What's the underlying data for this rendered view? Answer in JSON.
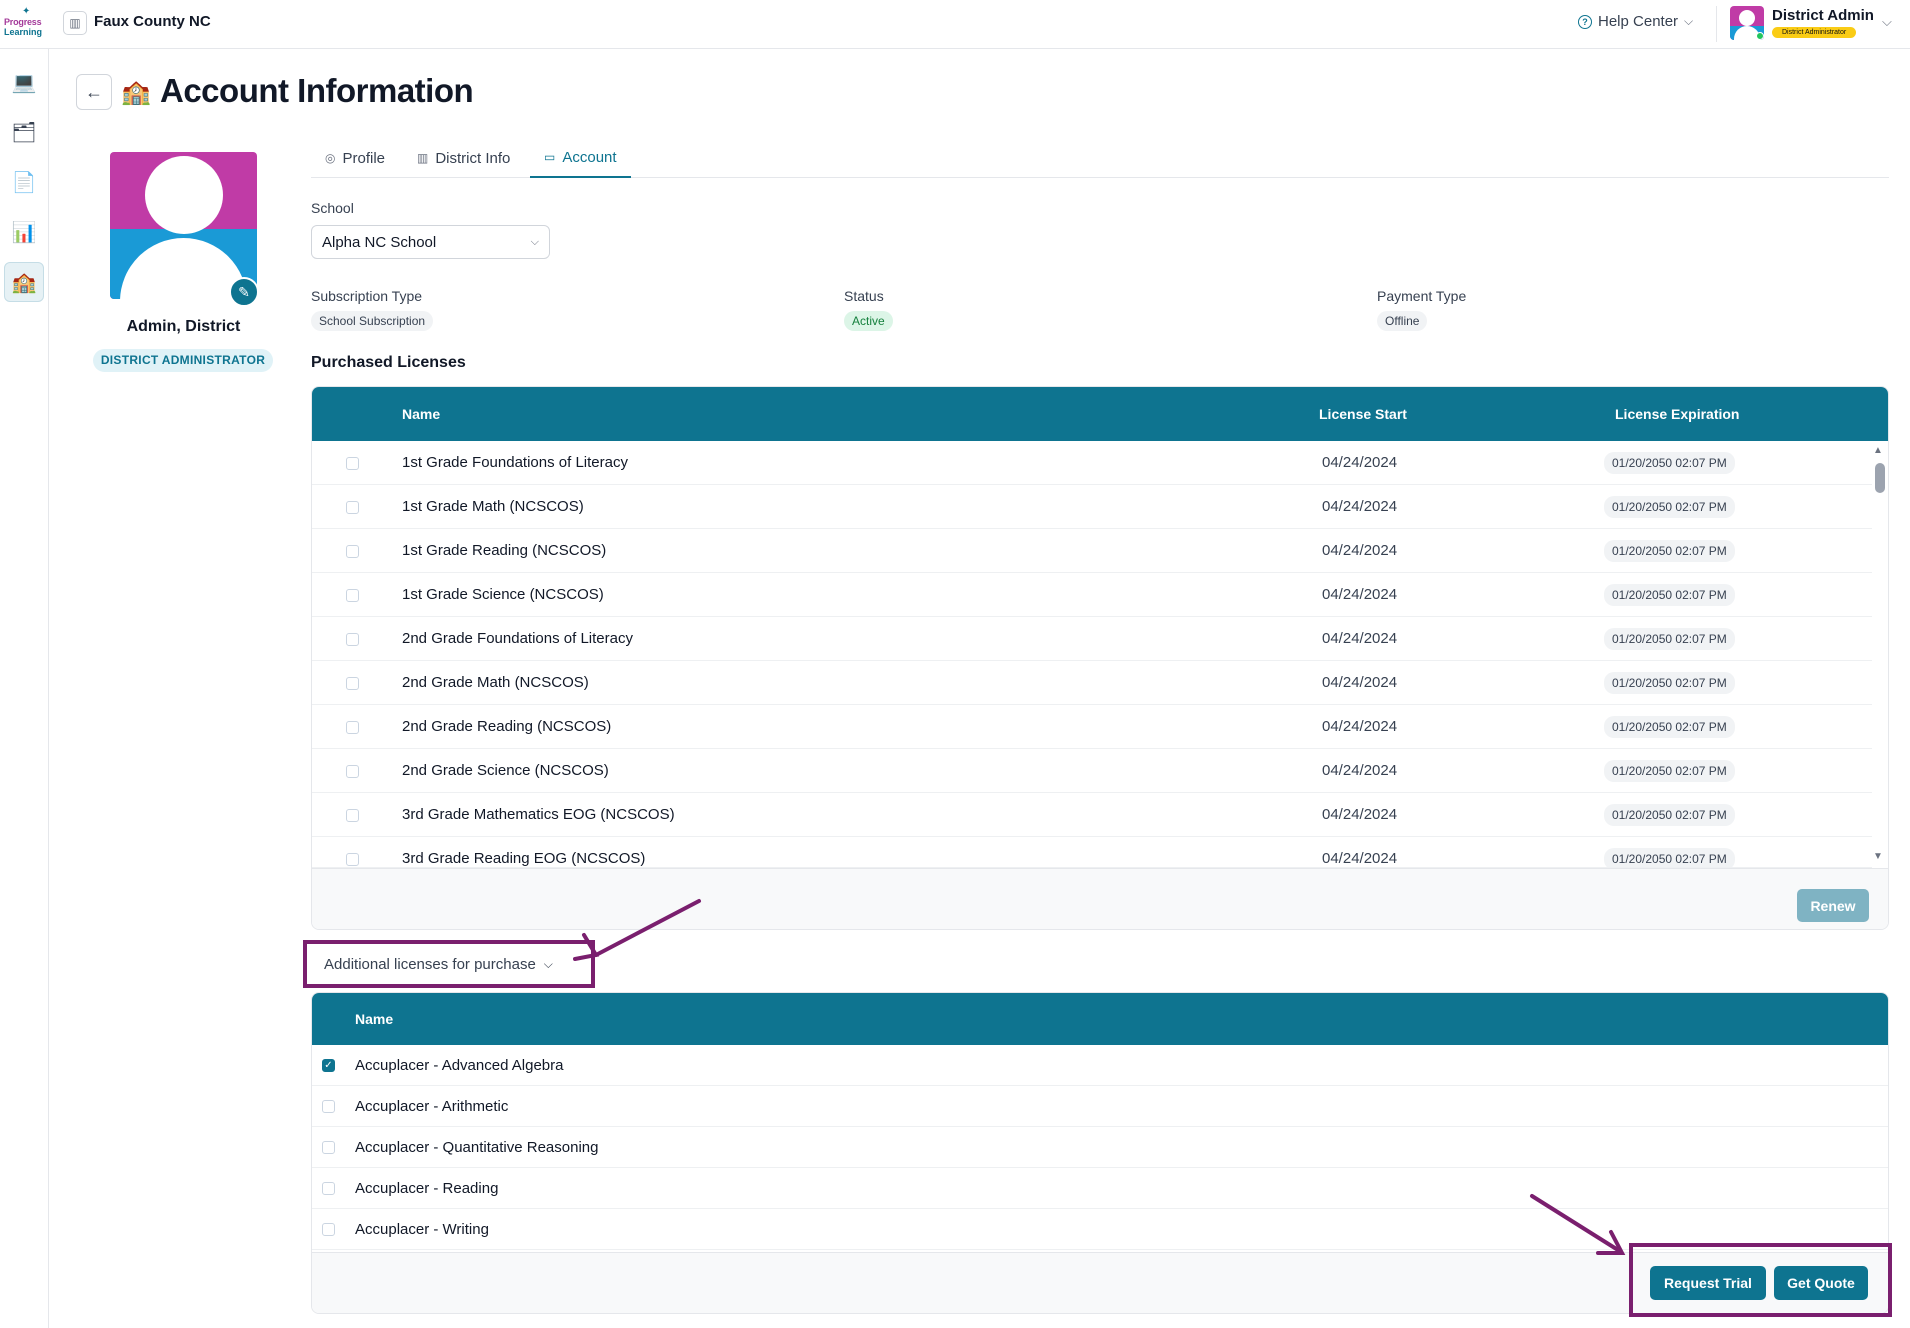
{
  "header": {
    "logo_line1": "Progress",
    "logo_line2": "Learning",
    "org_name": "Faux County NC",
    "help_label": "Help Center",
    "user_name": "District Admin",
    "user_role": "District Administrator"
  },
  "rail": {
    "items": [
      {
        "icon": "laptop-icon"
      },
      {
        "icon": "folders-icon"
      },
      {
        "icon": "report-icon"
      },
      {
        "icon": "analytics-icon"
      },
      {
        "icon": "school-icon",
        "active": true
      }
    ]
  },
  "page": {
    "title": "Account Information"
  },
  "profile": {
    "name": "Admin, District",
    "role": "DISTRICT ADMINISTRATOR"
  },
  "tabs": [
    {
      "label": "Profile",
      "icon": "user-circle-icon"
    },
    {
      "label": "District Info",
      "icon": "building-icon"
    },
    {
      "label": "Account",
      "icon": "card-icon",
      "active": true
    }
  ],
  "account": {
    "school_label": "School",
    "school_value": "Alpha NC School",
    "subscription_label": "Subscription Type",
    "subscription_value": "School Subscription",
    "status_label": "Status",
    "status_value": "Active",
    "payment_label": "Payment Type",
    "payment_value": "Offline"
  },
  "purchased": {
    "title": "Purchased Licenses",
    "columns": {
      "name": "Name",
      "start": "License Start",
      "expiration": "License Expiration"
    },
    "rows": [
      {
        "name": "1st Grade Foundations of Literacy",
        "start": "04/24/2024",
        "expiration": "01/20/2050 02:07 PM"
      },
      {
        "name": "1st Grade Math (NCSCOS)",
        "start": "04/24/2024",
        "expiration": "01/20/2050 02:07 PM"
      },
      {
        "name": "1st Grade Reading (NCSCOS)",
        "start": "04/24/2024",
        "expiration": "01/20/2050 02:07 PM"
      },
      {
        "name": "1st Grade Science (NCSCOS)",
        "start": "04/24/2024",
        "expiration": "01/20/2050 02:07 PM"
      },
      {
        "name": "2nd Grade Foundations of Literacy",
        "start": "04/24/2024",
        "expiration": "01/20/2050 02:07 PM"
      },
      {
        "name": "2nd Grade Math (NCSCOS)",
        "start": "04/24/2024",
        "expiration": "01/20/2050 02:07 PM"
      },
      {
        "name": "2nd Grade Reading (NCSCOS)",
        "start": "04/24/2024",
        "expiration": "01/20/2050 02:07 PM"
      },
      {
        "name": "2nd Grade Science (NCSCOS)",
        "start": "04/24/2024",
        "expiration": "01/20/2050 02:07 PM"
      },
      {
        "name": "3rd Grade Mathematics EOG (NCSCOS)",
        "start": "04/24/2024",
        "expiration": "01/20/2050 02:07 PM"
      },
      {
        "name": "3rd Grade Reading EOG (NCSCOS)",
        "start": "04/24/2024",
        "expiration": "01/20/2050 02:07 PM"
      }
    ],
    "renew_label": "Renew"
  },
  "additional": {
    "toggle_label": "Additional licenses for purchase",
    "column_name": "Name",
    "rows": [
      {
        "name": "Accuplacer - Advanced Algebra",
        "checked": true
      },
      {
        "name": "Accuplacer - Arithmetic",
        "checked": false
      },
      {
        "name": "Accuplacer - Quantitative Reasoning",
        "checked": false
      },
      {
        "name": "Accuplacer - Reading",
        "checked": false
      },
      {
        "name": "Accuplacer - Writing",
        "checked": false
      }
    ],
    "request_trial_label": "Request Trial",
    "get_quote_label": "Get Quote"
  },
  "colors": {
    "brand_teal": "#0e7490",
    "annotation_purple": "#7a1f6e"
  }
}
